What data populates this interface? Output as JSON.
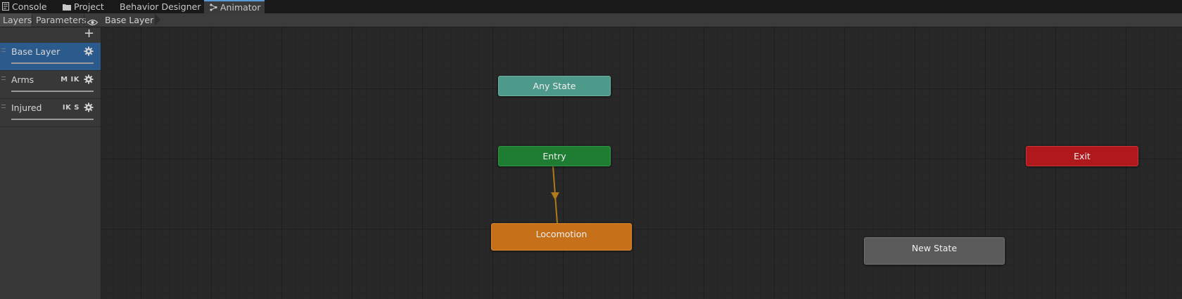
{
  "tabs": [
    {
      "label": "Console",
      "icon": "console-icon"
    },
    {
      "label": "Project",
      "icon": "folder-icon"
    },
    {
      "label": "Behavior Designer",
      "icon": ""
    },
    {
      "label": "Animator",
      "icon": "animator-icon",
      "active": true
    }
  ],
  "toolbar": {
    "layers_label": "Layers",
    "parameters_label": "Parameters",
    "visibility_icon": "eye-icon",
    "breadcrumb": "Base Layer"
  },
  "layers_panel": {
    "add_icon": "plus-icon",
    "layers": [
      {
        "name": "Base Layer",
        "flags": "",
        "selected": true
      },
      {
        "name": "Arms",
        "flags": "M IK",
        "selected": false
      },
      {
        "name": "Injured",
        "flags": "IK S",
        "selected": false
      }
    ]
  },
  "graph": {
    "nodes": {
      "any_state": {
        "label": "Any State",
        "color": "#4e9a8a"
      },
      "entry": {
        "label": "Entry",
        "color": "#1e7d32"
      },
      "locomotion": {
        "label": "Locomotion",
        "color": "#c7701a"
      },
      "exit": {
        "label": "Exit",
        "color": "#b0191c"
      },
      "new_state": {
        "label": "New State",
        "color": "#5a5a5a"
      }
    },
    "transition_color": "#b07a1a"
  }
}
